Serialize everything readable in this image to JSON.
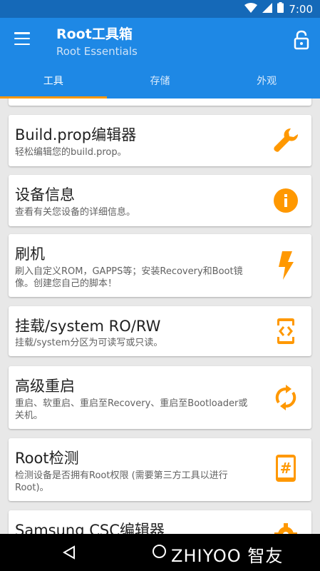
{
  "status_bar": {
    "time": "7:00"
  },
  "app_bar": {
    "title": "Root工具箱",
    "subtitle": "Root Essentials"
  },
  "tabs": [
    {
      "label": "工具",
      "active": true
    },
    {
      "label": "存储",
      "active": false
    },
    {
      "label": "外观",
      "active": false
    }
  ],
  "cards": [
    {
      "title": "Build.prop编辑器",
      "desc": "轻松编辑您的build.prop。",
      "icon": "wrench-icon"
    },
    {
      "title": "设备信息",
      "desc": "查看有关您设备的详细信息。",
      "icon": "info-icon"
    },
    {
      "title": "刷机",
      "desc": "刷入自定义ROM，GAPPS等；安装Recovery和Boot镜像。创建您自己的脚本！",
      "icon": "flash-icon"
    },
    {
      "title": "挂载/system RO/RW",
      "desc": "挂载/system分区为可读写或只读。",
      "icon": "mount-icon"
    },
    {
      "title": "高级重启",
      "desc": "重启、软重启、重启至Recovery、重启至Bootloader或关机。",
      "icon": "reboot-icon"
    },
    {
      "title": "Root检测",
      "desc": "检测设备是否拥有Root权限 (需要第三方工具以进行Root)。",
      "icon": "root-check-icon"
    },
    {
      "title": "Samsung CSC编辑器",
      "desc": "",
      "icon": "gear-icon"
    }
  ],
  "watermark": "ZHIYOO 智友",
  "colors": {
    "primary": "#1e88e5",
    "status_bar": "#1569b8",
    "accent": "#ff9800"
  }
}
